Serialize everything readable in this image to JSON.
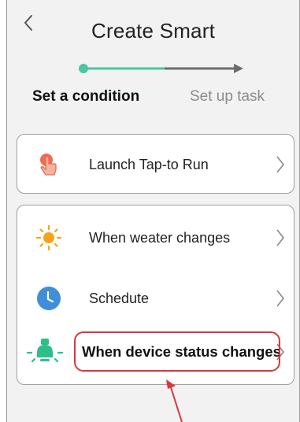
{
  "header": {
    "title": "Create Smart",
    "back_icon": "chevron-left-icon"
  },
  "steps": [
    {
      "label": "Set a condition",
      "active": true
    },
    {
      "label": "Set up task",
      "active": false
    }
  ],
  "colors": {
    "accent": "#48c7a0",
    "inactive_step": "#8c8c8c",
    "highlight": "#d9363e",
    "sun": "#f7a21b",
    "clock": "#3f8fd8",
    "hand": "#f06a55",
    "lamp": "#2dbf8a"
  },
  "tap_to_run": {
    "label": "Launch Tap-to Run",
    "icon": "tap-hand-icon"
  },
  "conditions": [
    {
      "label": "When weater changes",
      "icon": "sun-icon"
    },
    {
      "label": "Schedute",
      "icon": "clock-icon"
    },
    {
      "label": "When device status changes",
      "icon": "lamp-icon",
      "highlighted": true
    }
  ]
}
